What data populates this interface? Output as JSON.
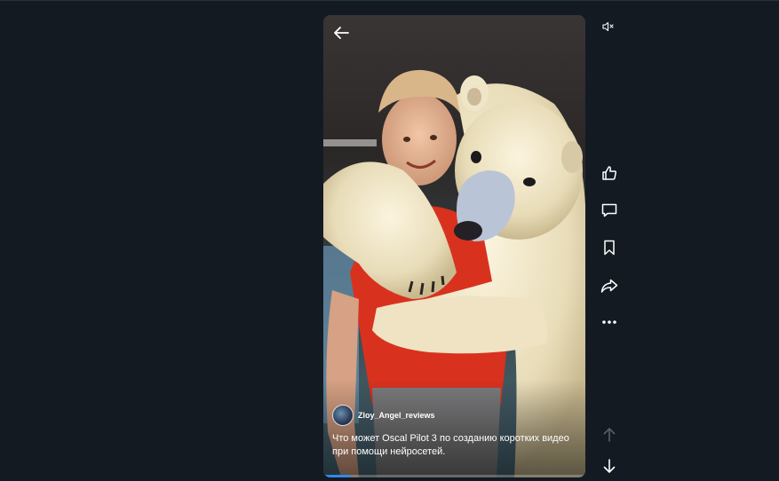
{
  "video": {
    "author": "Zloy_Angel_reviews",
    "caption": "Что может Oscal Pilot 3 по созданию коротких видео при помощи нейросетей.",
    "progress": 0.1
  },
  "icons": {
    "back": "arrow-left-icon",
    "mute": "speaker-muted-icon",
    "like": "thumbs-up-icon",
    "comment": "comment-icon",
    "bookmark": "bookmark-icon",
    "share": "share-arrow-icon",
    "more": "more-dots-icon",
    "prev": "arrow-up-icon",
    "next": "arrow-down-icon"
  },
  "colors": {
    "background": "#141a22",
    "accent": "#2f8ae6",
    "icon": "#ffffff"
  }
}
